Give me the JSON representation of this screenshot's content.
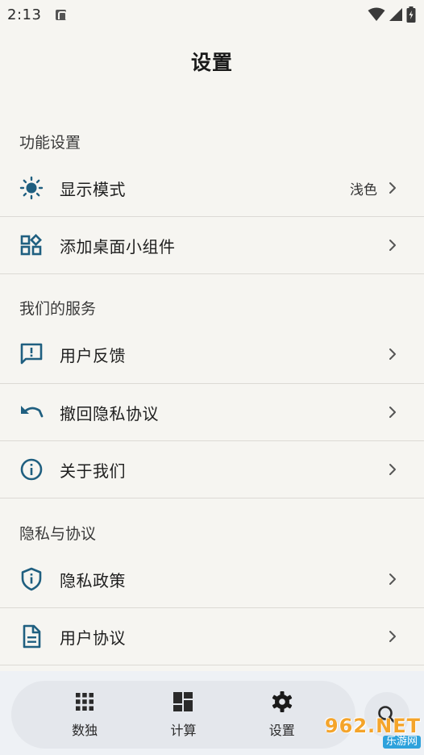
{
  "status_bar": {
    "time": "2:13"
  },
  "title": "设置",
  "sections": [
    {
      "header": "功能设置",
      "items": [
        {
          "label": "显示模式",
          "value": "浅色",
          "icon": "brightness-icon"
        },
        {
          "label": "添加桌面小组件",
          "icon": "widgets-icon"
        }
      ]
    },
    {
      "header": "我们的服务",
      "items": [
        {
          "label": "用户反馈",
          "icon": "feedback-icon"
        },
        {
          "label": "撤回隐私协议",
          "icon": "undo-icon"
        },
        {
          "label": "关于我们",
          "icon": "info-icon"
        }
      ]
    },
    {
      "header": "隐私与协议",
      "items": [
        {
          "label": "隐私政策",
          "icon": "shield-icon"
        },
        {
          "label": "用户协议",
          "icon": "document-icon"
        }
      ]
    }
  ],
  "bottom_nav": {
    "items": [
      {
        "label": "数独",
        "icon": "grid-icon"
      },
      {
        "label": "计算",
        "icon": "dashboard-icon"
      },
      {
        "label": "设置",
        "icon": "gear-icon"
      }
    ]
  },
  "watermark": {
    "brand": "962.NET",
    "sub": "乐游网"
  },
  "colors": {
    "icon_accent": "#1f5f80",
    "background": "#f6f5f1",
    "nav_bg": "#e4e7ec"
  }
}
